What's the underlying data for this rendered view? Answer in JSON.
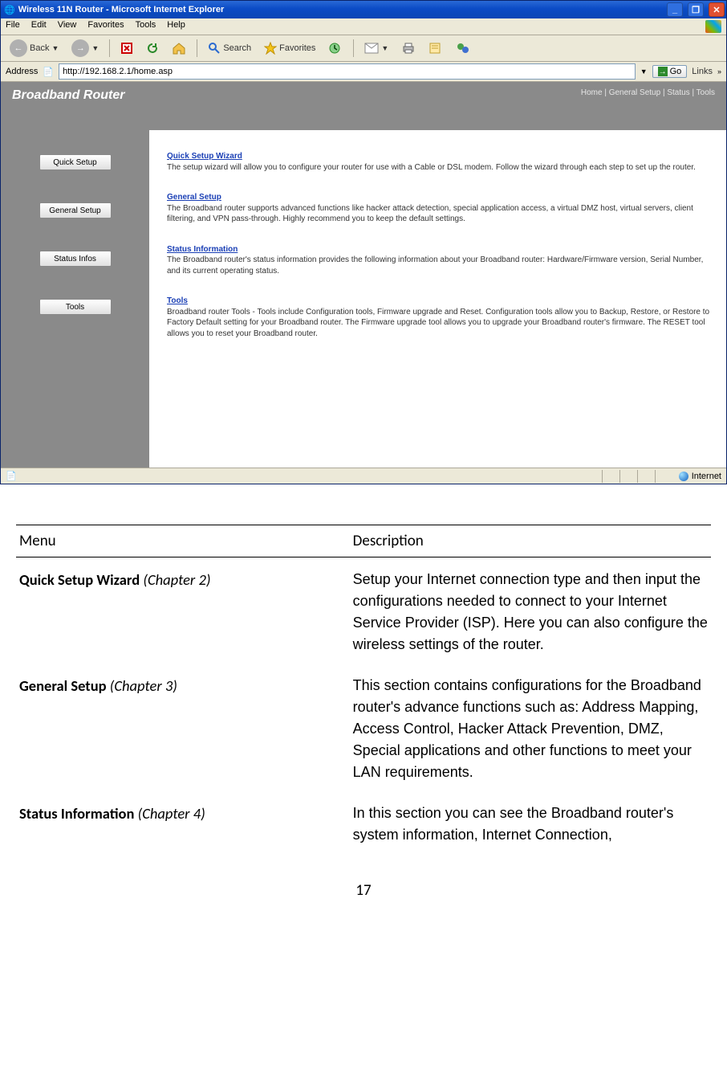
{
  "ie": {
    "title": "Wireless 11N Router - Microsoft Internet Explorer",
    "menus": [
      "File",
      "Edit",
      "View",
      "Favorites",
      "Tools",
      "Help"
    ],
    "toolbar": {
      "back": "Back",
      "search": "Search",
      "favorites": "Favorites"
    },
    "address_label": "Address",
    "address_value": "http://192.168.2.1/home.asp",
    "go": "Go",
    "links": "Links",
    "status_zone": "Internet"
  },
  "router": {
    "brand": "Broadband Router",
    "header_links": "Home | General Setup | Status | Tools",
    "sidebar": [
      "Quick Setup",
      "General Setup",
      "Status Infos",
      "Tools"
    ],
    "sections": [
      {
        "title": "Quick Setup Wizard",
        "body": "The setup wizard will allow you to configure your router for use with a Cable or DSL modem. Follow the wizard through each step to set up the router."
      },
      {
        "title": "General Setup",
        "body": "The Broadband router supports advanced functions like hacker attack detection, special application access, a virtual DMZ host, virtual servers, client filtering, and VPN pass-through. Highly recommend you to keep the default settings."
      },
      {
        "title": "Status Information",
        "body": "The Broadband router's status information provides the following information about your Broadband router: Hardware/Firmware version, Serial Number, and its current operating status."
      },
      {
        "title": "Tools",
        "body": "Broadband router Tools - Tools include Configuration tools, Firmware upgrade and Reset. Configuration tools allow you to Backup, Restore, or Restore to Factory Default setting for your Broadband router. The Firmware upgrade tool allows you to upgrade your Broadband router's firmware. The RESET tool allows you to reset your Broadband router."
      }
    ]
  },
  "doc": {
    "headers": {
      "menu": "Menu",
      "desc": "Description"
    },
    "rows": [
      {
        "menu_bold": "Quick Setup Wizard",
        "menu_italic": " (Chapter 2)",
        "desc": "Setup your Internet connection type and then input the configurations needed to connect to your Internet Service Provider (ISP). Here you can also configure the wireless settings of the router."
      },
      {
        "menu_bold": "General Setup",
        "menu_italic": " (Chapter 3)",
        "desc": "This section contains configurations for the Broadband router's advance functions such as: Address Mapping, Access Control, Hacker Attack Prevention, DMZ, Special applications and other functions to meet your LAN requirements."
      },
      {
        "menu_bold": "Status Information",
        "menu_italic": " (Chapter 4)",
        "desc": "In this section you can see the Broadband router's system information, Internet Connection,"
      }
    ],
    "page_number": "17"
  }
}
